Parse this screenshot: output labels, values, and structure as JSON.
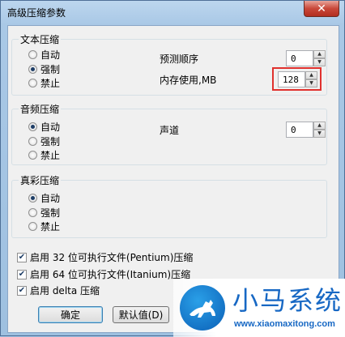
{
  "window": {
    "title": "高级压缩参数",
    "close_label": "✕"
  },
  "text_compression": {
    "title": "文本压缩",
    "options": [
      "自动",
      "强制",
      "禁止"
    ],
    "selected": 1,
    "predict_order_label": "预测顺序",
    "predict_order_value": "0",
    "memory_label": "内存使用,MB",
    "memory_value": "128"
  },
  "audio_compression": {
    "title": "音频压缩",
    "options": [
      "自动",
      "强制",
      "禁止"
    ],
    "selected": 0,
    "channels_label": "声道",
    "channels_value": "0"
  },
  "truecolor_compression": {
    "title": "真彩压缩",
    "options": [
      "自动",
      "强制",
      "禁止"
    ],
    "selected": 0
  },
  "checkboxes": [
    {
      "label": "启用 32 位可执行文件(Pentium)压缩",
      "checked": true
    },
    {
      "label": "启用 64 位可执行文件(Itanium)压缩",
      "checked": true
    },
    {
      "label": "启用 delta 压缩",
      "checked": true
    }
  ],
  "buttons": {
    "ok": "确定",
    "defaults": "默认值(D)"
  },
  "watermark": {
    "brand": "小马系统",
    "url": "www.xiaomaxitong.com"
  },
  "colors": {
    "highlight": "#e0312e",
    "brand": "#1768c4"
  }
}
